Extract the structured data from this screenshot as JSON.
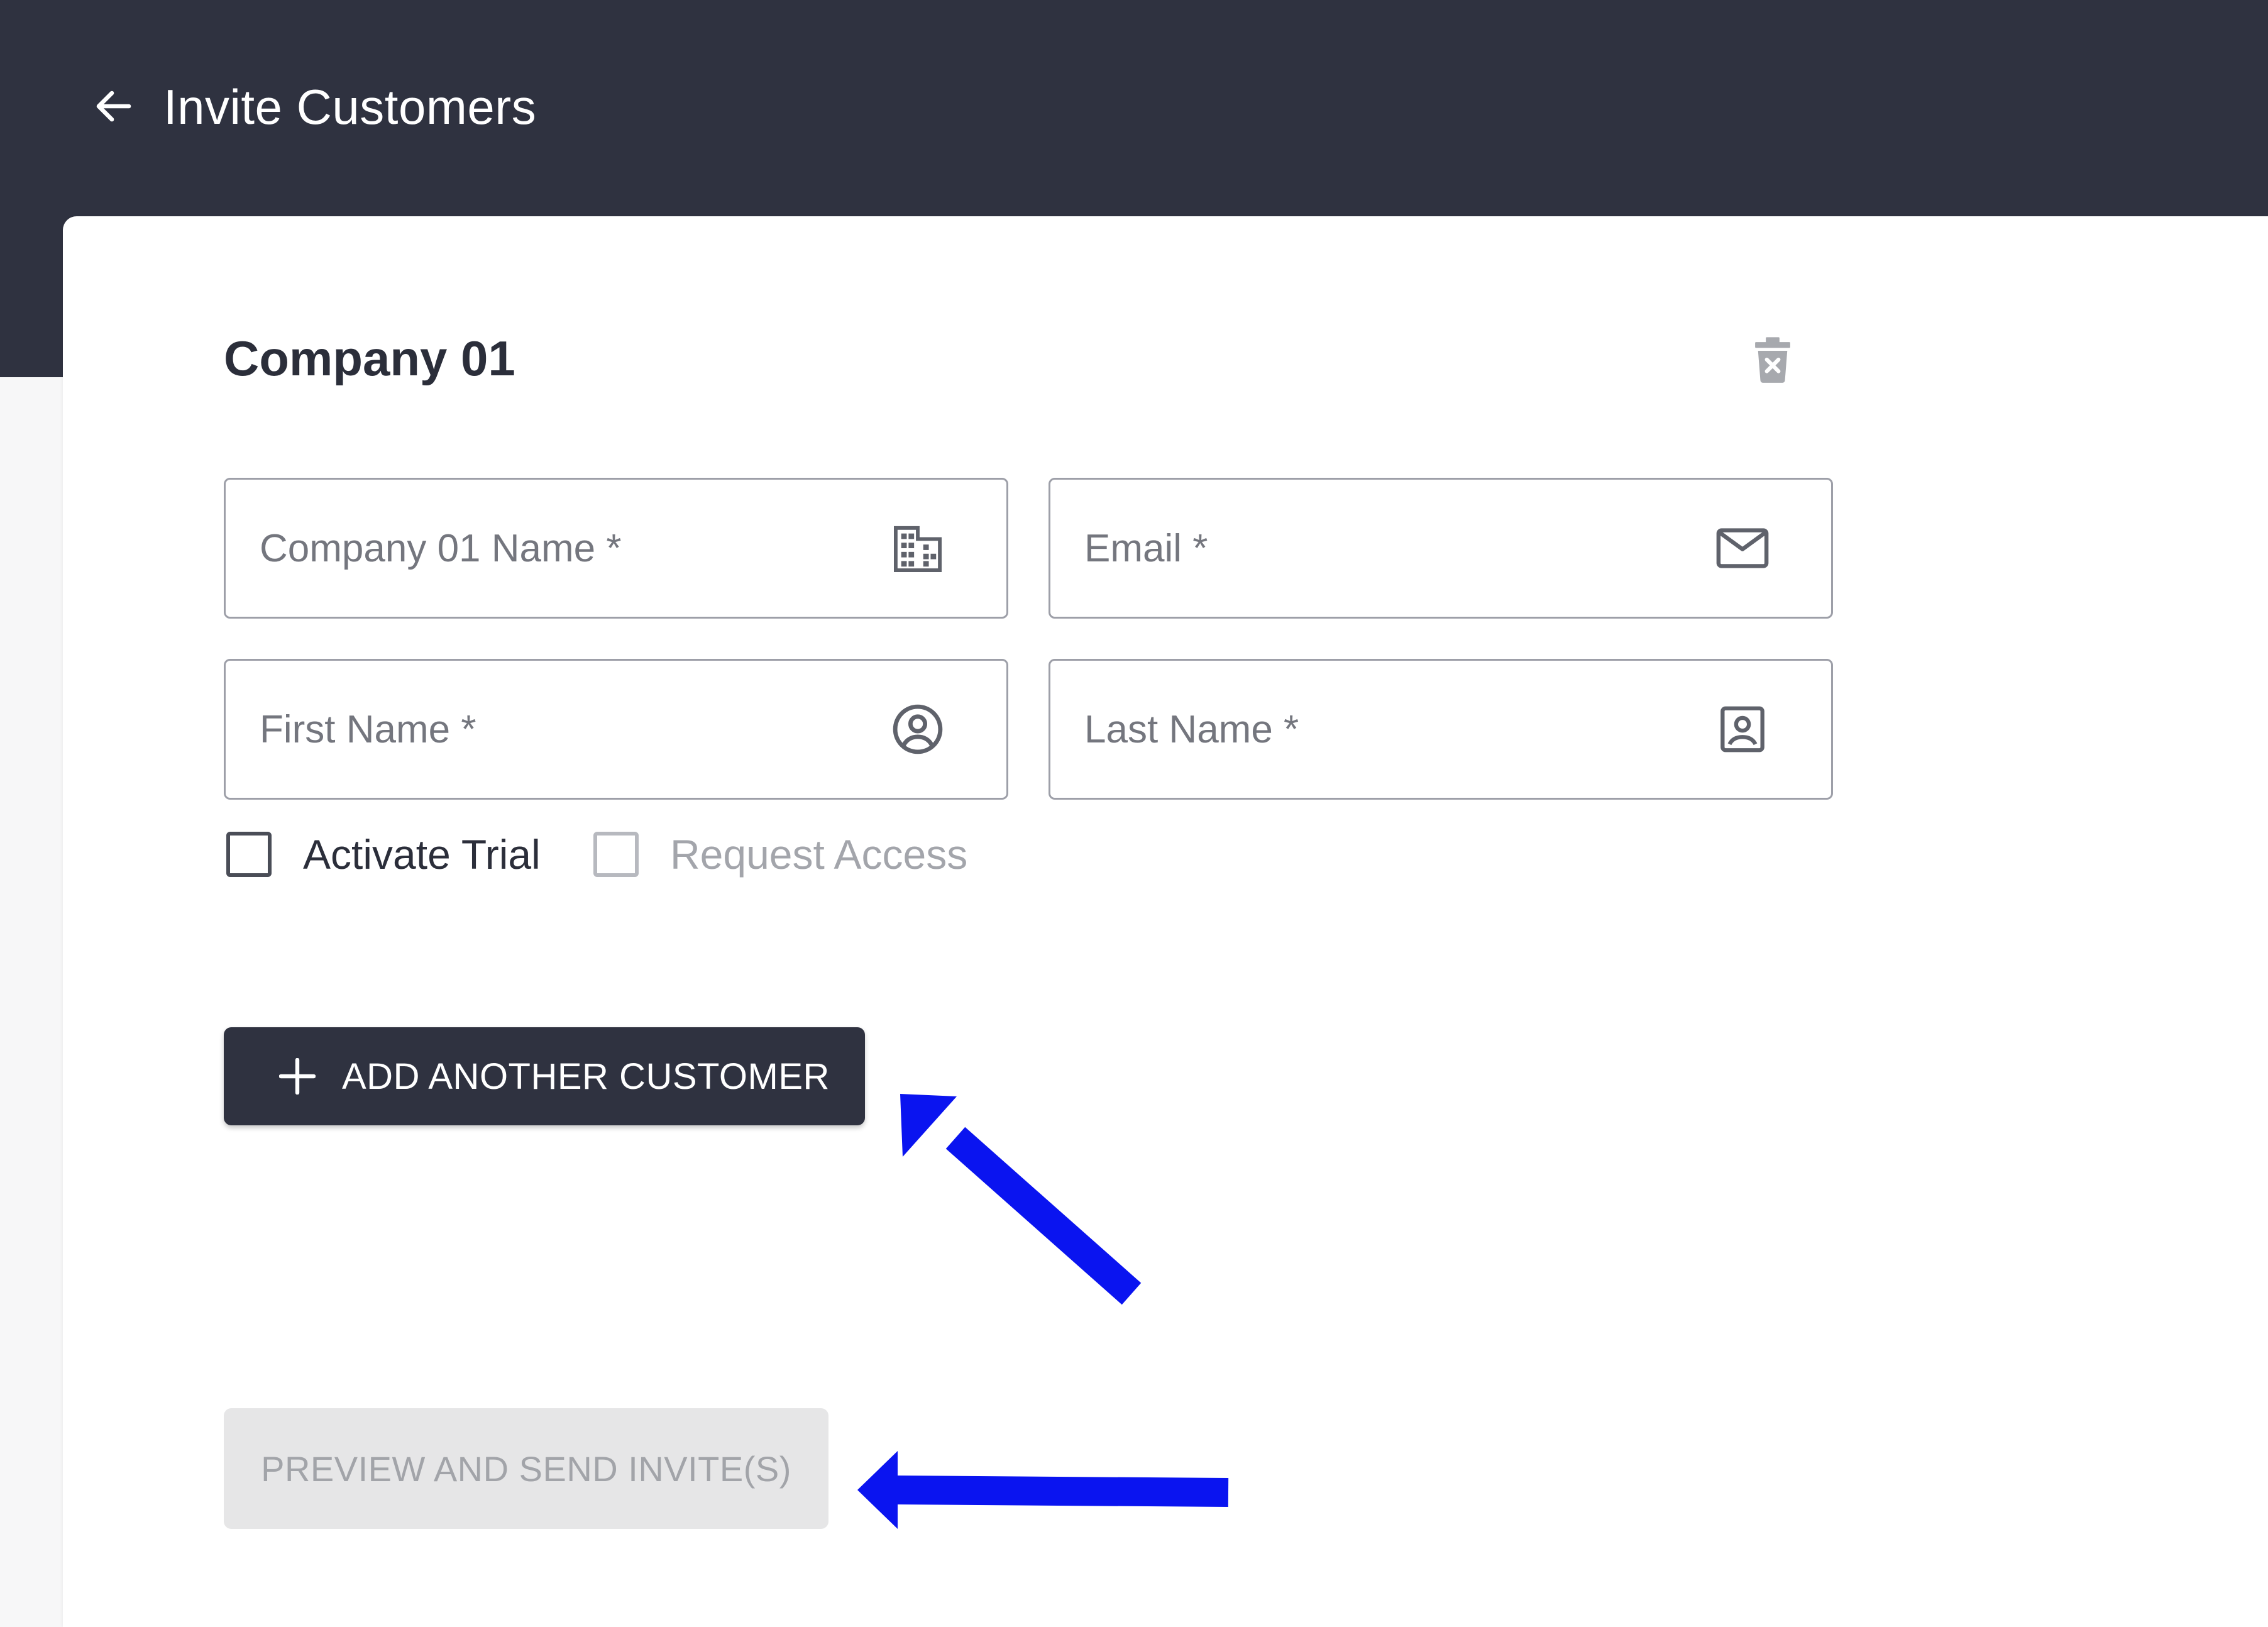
{
  "header": {
    "title": "Invite Customers",
    "back_icon": "arrow-left-icon"
  },
  "section": {
    "title": "Company 01",
    "delete_icon": "trash-x-icon"
  },
  "fields": {
    "company": {
      "placeholder": "Company 01 Name *",
      "value": "",
      "icon": "building-icon"
    },
    "email": {
      "placeholder": "Email *",
      "value": "",
      "icon": "mail-icon"
    },
    "first_name": {
      "placeholder": "First Name *",
      "value": "",
      "icon": "user-circle-icon"
    },
    "last_name": {
      "placeholder": "Last Name *",
      "value": "",
      "icon": "contact-card-icon"
    }
  },
  "options": {
    "activate_trial": {
      "label": "Activate Trial",
      "checked": false,
      "enabled": true
    },
    "request_access": {
      "label": "Request Access",
      "checked": false,
      "enabled": false
    }
  },
  "actions": {
    "add_customer_label": "ADD ANOTHER CUSTOMER",
    "add_icon": "plus-icon",
    "preview_send_label": "PREVIEW AND SEND INVITE(S)",
    "preview_send_enabled": false
  },
  "colors": {
    "header_bg": "#2f3240",
    "primary_button": "#2f3240",
    "disabled_button": "#e6e6e7",
    "annotation_arrow": "#0a14f0"
  }
}
